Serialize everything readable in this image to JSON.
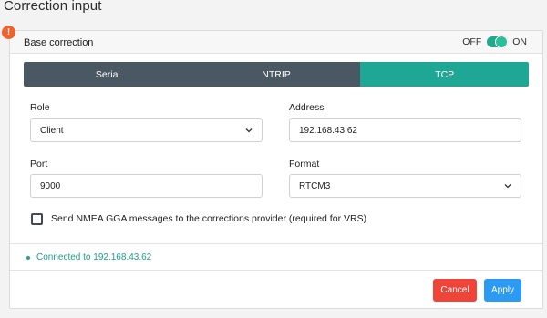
{
  "page": {
    "title": "Correction input"
  },
  "card": {
    "title": "Base correction",
    "toggle": {
      "off_label": "OFF",
      "on_label": "ON",
      "state": "on",
      "color": "#1faa8a"
    }
  },
  "tabs": [
    {
      "label": "Serial",
      "active": false
    },
    {
      "label": "NTRIP",
      "active": false
    },
    {
      "label": "TCP",
      "active": true
    }
  ],
  "colors": {
    "tab_bg": "#495863",
    "tab_active": "#1ea795",
    "cancel": "#f04438",
    "apply": "#2b9af3",
    "status": "#1d9e8c",
    "warning": "#f0622d"
  },
  "form": {
    "role": {
      "label": "Role",
      "value": "Client"
    },
    "address": {
      "label": "Address",
      "value": "192.168.43.62"
    },
    "port": {
      "label": "Port",
      "value": "9000"
    },
    "format": {
      "label": "Format",
      "value": "RTCM3"
    },
    "nmea": {
      "label": "Send NMEA GGA messages to the corrections provider (required for VRS)",
      "checked": false
    }
  },
  "status": {
    "text": "Connected to 192.168.43.62"
  },
  "buttons": {
    "cancel": "Cancel",
    "apply": "Apply"
  },
  "icons": {
    "warning": "warning-icon",
    "chevron": "chevron-down-icon"
  }
}
